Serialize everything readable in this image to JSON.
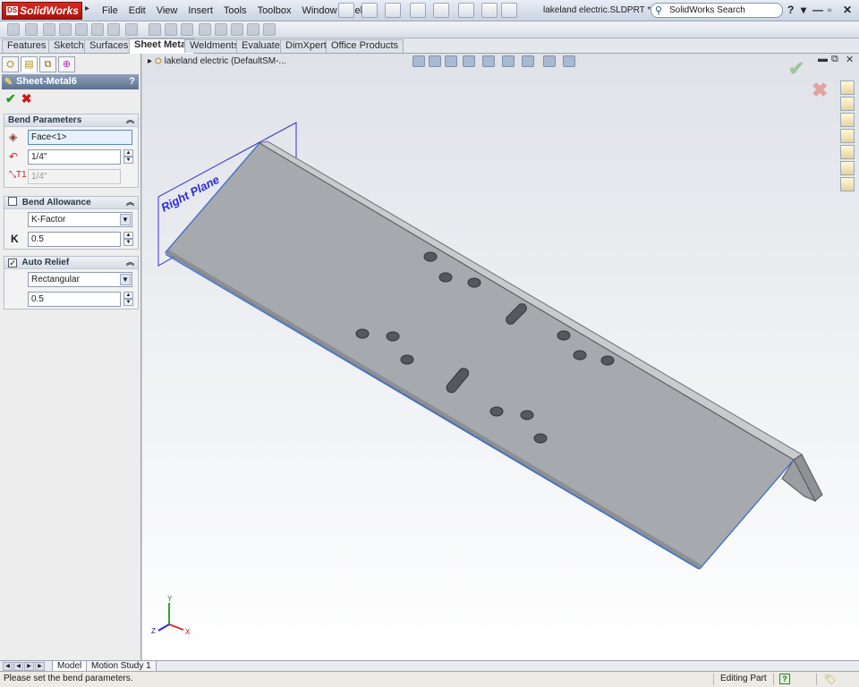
{
  "app": {
    "logo_text": "SolidWorks",
    "logo_badge": "DS",
    "document_title": "lakeland electric.SLDPRT *",
    "search_placeholder": "SolidWorks Search",
    "window_controls": [
      "?",
      "▾",
      "—",
      "▫",
      "✕"
    ]
  },
  "menu": [
    "File",
    "Edit",
    "View",
    "Insert",
    "Tools",
    "Toolbox",
    "Window",
    "Help"
  ],
  "command_tabs": [
    {
      "label": "Features"
    },
    {
      "label": "Sketch"
    },
    {
      "label": "Surfaces"
    },
    {
      "label": "Sheet Metal",
      "active": true
    },
    {
      "label": "Weldments"
    },
    {
      "label": "Evaluate"
    },
    {
      "label": "DimXpert"
    },
    {
      "label": "Office Products"
    }
  ],
  "property_manager": {
    "title": "Sheet-Metal6",
    "help": "?",
    "ok_symbol": "✔",
    "cancel_symbol": "✖",
    "bend_parameters": {
      "heading": "Bend Parameters",
      "face_value": "Face<1>",
      "radius_value": "1/4\"",
      "thickness_value": "1/4\""
    },
    "bend_allowance": {
      "heading": "Bend Allowance",
      "type": "K-Factor",
      "k_label": "K",
      "k_value": "0.5"
    },
    "auto_relief": {
      "heading": "Auto Relief",
      "checked": true,
      "type": "Rectangular",
      "ratio_value": "0.5"
    }
  },
  "graphics": {
    "tree_label": "lakeland electric  (DefaultSM-...",
    "plane_label": "Right Plane",
    "triad": {
      "x": "X",
      "y": "Y",
      "z": "Z"
    }
  },
  "bottom_tabs": [
    "Model",
    "Motion Study 1"
  ],
  "status": {
    "message": "Please set the bend parameters.",
    "mode": "Editing Part",
    "help_icon": "?"
  },
  "colors": {
    "part_face": "#a6a9ad",
    "part_edge": "#3b6fd4",
    "plane_color": "#2a2ad8",
    "header_blue": "#5d7190"
  }
}
